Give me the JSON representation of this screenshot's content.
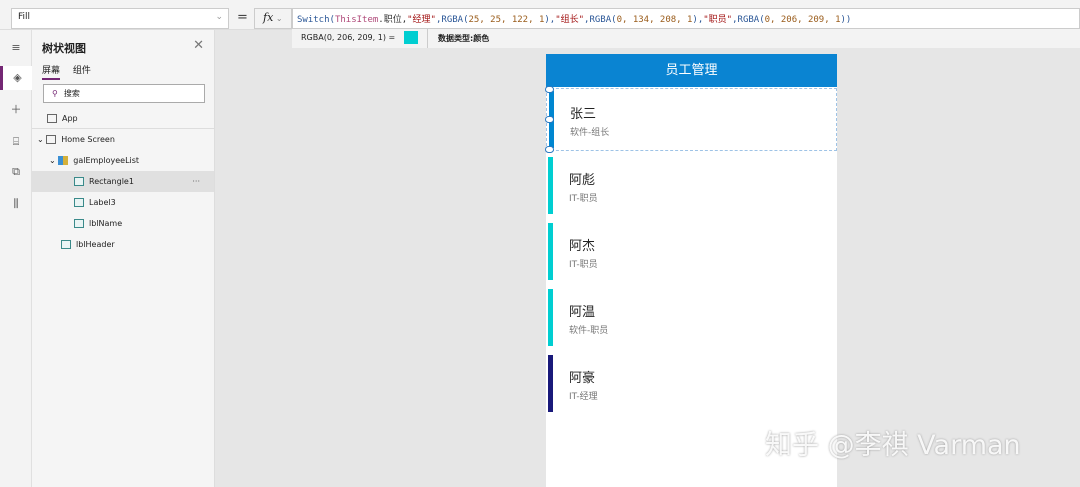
{
  "formula_bar": {
    "property": "Fill",
    "equals": "=",
    "fx": "fx",
    "formula": [
      {
        "t": "Switch(",
        "c": "f"
      },
      {
        "t": "ThisItem",
        "c": "k"
      },
      {
        "t": ".职位,",
        "c": "d"
      },
      {
        "t": "\"经理\"",
        "c": "s"
      },
      {
        "t": ",RGBA(",
        "c": "f"
      },
      {
        "t": "25, 25, 122, 1",
        "c": "n"
      },
      {
        "t": "),",
        "c": "f"
      },
      {
        "t": "\"组长\"",
        "c": "s"
      },
      {
        "t": ",RGBA(",
        "c": "f"
      },
      {
        "t": "0, 134, 208, 1",
        "c": "n"
      },
      {
        "t": "),",
        "c": "f"
      },
      {
        "t": "\"职员\"",
        "c": "s"
      },
      {
        "t": ",RGBA(",
        "c": "f"
      },
      {
        "t": "0, 206, 209, 1",
        "c": "n"
      },
      {
        "t": "))",
        "c": "f"
      }
    ],
    "result": "RGBA(0, 206, 209, 1)  =",
    "result_color": "#00ced1",
    "data_type": "数据类型:颜色"
  },
  "tree": {
    "title": "树状视图",
    "tabs": [
      "屏幕",
      "组件"
    ],
    "search_placeholder": "搜索",
    "nodes": [
      {
        "label": "App"
      },
      {
        "label": "Home Screen"
      },
      {
        "label": "galEmployeeList"
      },
      {
        "label": "Rectangle1",
        "more": "···"
      },
      {
        "label": "Label3"
      },
      {
        "label": "lblName"
      },
      {
        "label": "lblHeader"
      }
    ]
  },
  "app": {
    "header": "员工管理",
    "employees": [
      {
        "name": "张三",
        "info": "软件-组长",
        "color": "#0086d0"
      },
      {
        "name": "阿彪",
        "info": "IT-职员",
        "color": "#00ced1"
      },
      {
        "name": "阿杰",
        "info": "IT-职员",
        "color": "#00ced1"
      },
      {
        "name": "阿温",
        "info": "软件-职员",
        "color": "#00ced1"
      },
      {
        "name": "阿豪",
        "info": "IT-经理",
        "color": "#19197a"
      }
    ]
  },
  "watermark": "知乎 @李祺 Varman"
}
